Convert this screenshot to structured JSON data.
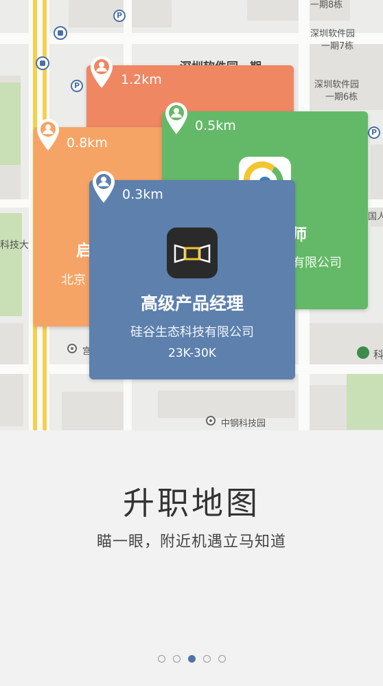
{
  "map": {
    "labels": [
      "一期8栋",
      "深圳软件园",
      "一期7栋",
      "深圳软件园",
      "一期6栋",
      "深圳软件园一期",
      "科技大",
      "国人",
      "中钢科技园",
      "科",
      "宫"
    ]
  },
  "cards": [
    {
      "id": "card-1",
      "distance": "1.2km",
      "color": "#ef8763",
      "title": "",
      "company": "",
      "salary": ""
    },
    {
      "id": "card-2",
      "distance": "0.8km",
      "color": "#f6a466",
      "title": "启",
      "company": "北京",
      "salary": ""
    },
    {
      "id": "card-3",
      "distance": "0.5km",
      "color": "#64b968",
      "title": "师",
      "company": "有限公司",
      "salary": ""
    },
    {
      "id": "card-4",
      "distance": "0.3km",
      "color": "#5d80ad",
      "title": "高级产品经理",
      "company": "硅谷生态科技有限公司",
      "salary": "23K-30K"
    }
  ],
  "feature": {
    "title": "升职地图",
    "subtitle": "瞄一眼，附近机遇立马知道"
  },
  "pager": {
    "count": 5,
    "active_index": 2
  },
  "colors": {
    "accent": "#4f74a6",
    "background": "#f2f2f2"
  }
}
